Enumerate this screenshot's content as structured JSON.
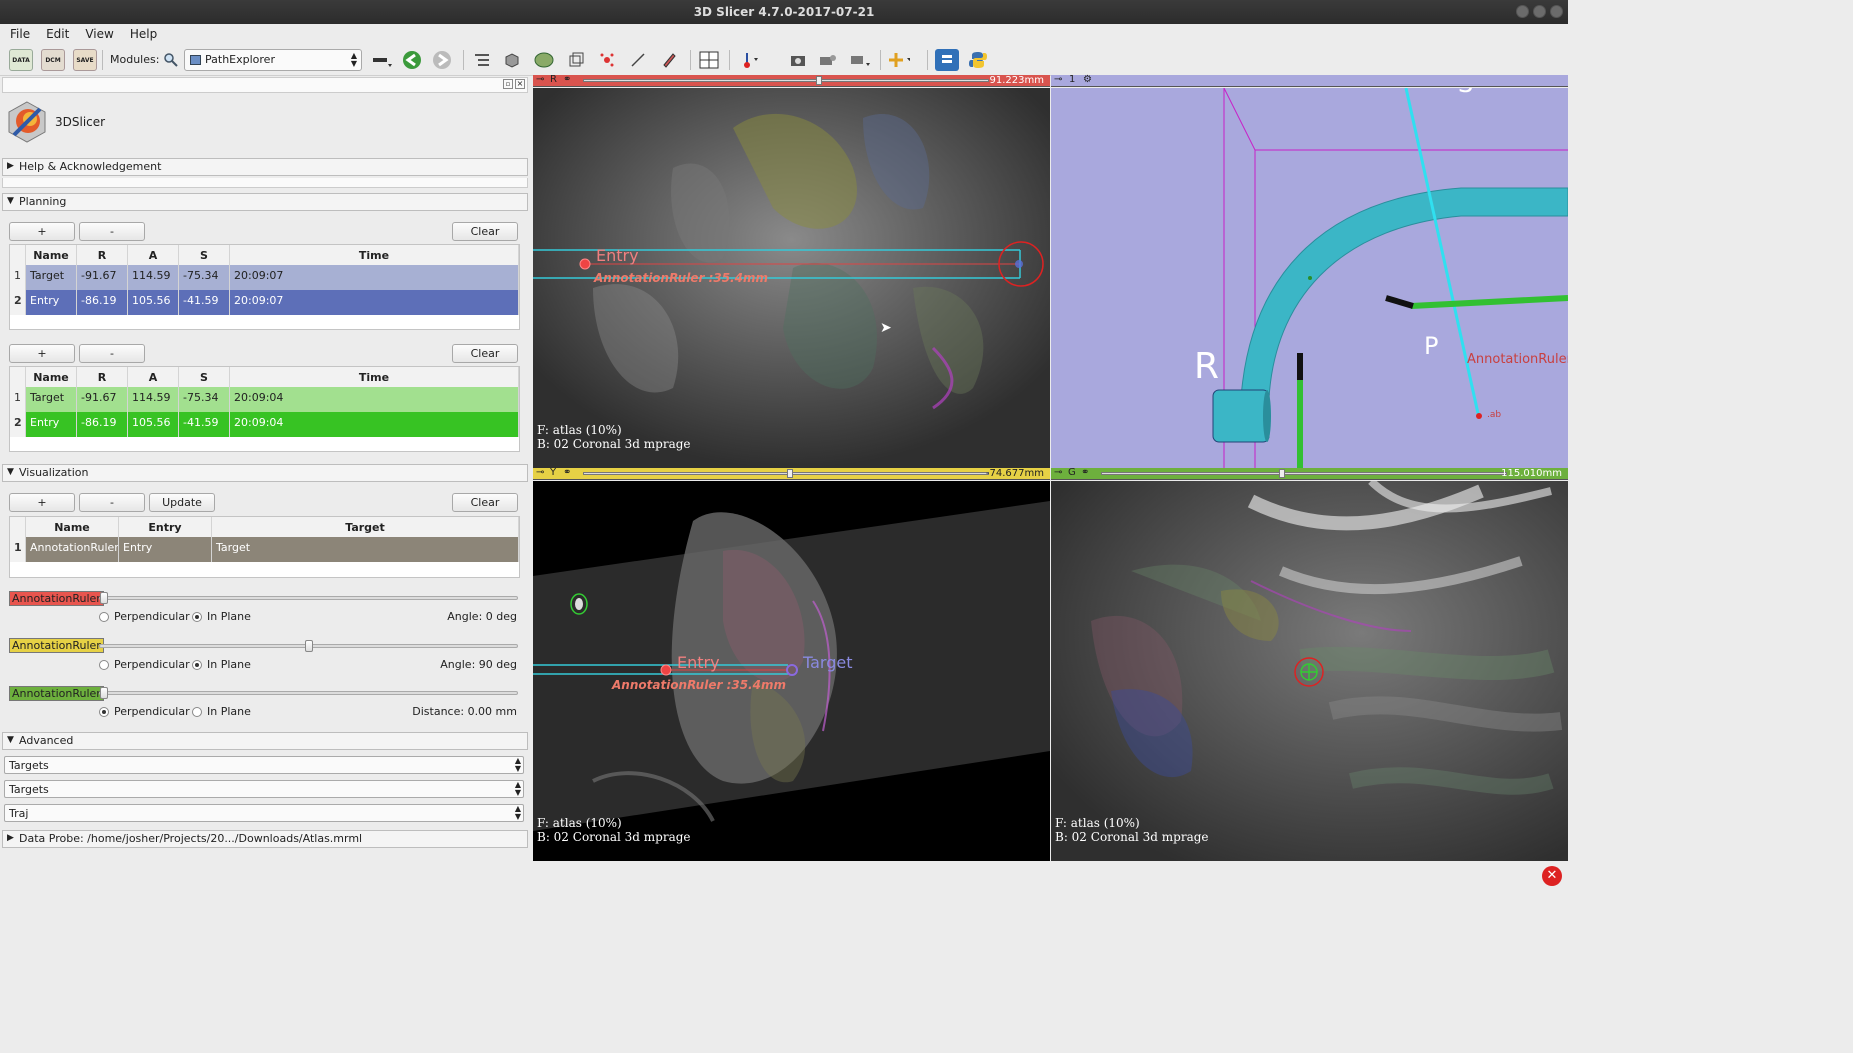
{
  "window": {
    "title": "3D Slicer 4.7.0-2017-07-21"
  },
  "menu": [
    "File",
    "Edit",
    "View",
    "Help"
  ],
  "toolbar": {
    "data_label": "DATA",
    "dcm_label": "DCM",
    "save_label": "SAVE",
    "modules_label": "Modules:",
    "module_selected": "PathExplorer"
  },
  "logo": {
    "text": "3DSlicer"
  },
  "sections": {
    "help": "Help & Acknowledgement",
    "planning": "Planning",
    "visualization": "Visualization",
    "advanced": "Advanced",
    "data_probe": "Data Probe: /home/josher/Projects/20.../Downloads/Atlas.mrml"
  },
  "buttons": {
    "add": "+",
    "remove": "-",
    "clear": "Clear",
    "update": "Update"
  },
  "target_table": {
    "columns": [
      "Name",
      "R",
      "A",
      "S",
      "Time"
    ],
    "rows": [
      {
        "num": "1",
        "name": "Target",
        "r": "-91.67",
        "a": "114.59",
        "s": "-75.34",
        "time": "20:09:07"
      },
      {
        "num": "2",
        "name": "Entry",
        "r": "-86.19",
        "a": "105.56",
        "s": "-41.59",
        "time": "20:09:07"
      }
    ]
  },
  "entry_table": {
    "columns": [
      "Name",
      "R",
      "A",
      "S",
      "Time"
    ],
    "rows": [
      {
        "num": "1",
        "name": "Target",
        "r": "-91.67",
        "a": "114.59",
        "s": "-75.34",
        "time": "20:09:04"
      },
      {
        "num": "2",
        "name": "Entry",
        "r": "-86.19",
        "a": "105.56",
        "s": "-41.59",
        "time": "20:09:04"
      }
    ]
  },
  "trajectory_table": {
    "columns": [
      "Name",
      "Entry",
      "Target"
    ],
    "rows": [
      {
        "num": "1",
        "name": "AnnotationRuler",
        "entry": "Entry",
        "target": "Target"
      }
    ]
  },
  "rulers": [
    {
      "label": "AnnotationRuler",
      "color": "#e8554e",
      "slider_fraction": 0.0,
      "opt1": "Perpendicular",
      "opt2": "In Plane",
      "selected": "In Plane",
      "value_text": "Angle:  0 deg"
    },
    {
      "label": "AnnotationRuler",
      "color": "#e6d145",
      "slider_fraction": 0.5,
      "opt1": "Perpendicular",
      "opt2": "In Plane",
      "selected": "In Plane",
      "value_text": "Angle:  90 deg"
    },
    {
      "label": "AnnotationRuler",
      "color": "#6db03d",
      "slider_fraction": 0.0,
      "opt1": "Perpendicular",
      "opt2": "In Plane",
      "selected": "Perpendicular",
      "value_text": "Distance:  0.00 mm"
    }
  ],
  "advanced_combos": [
    "Targets",
    "Targets",
    "Traj"
  ],
  "views": {
    "red": {
      "letter": "R",
      "offset": "91.223mm",
      "slider_fraction": 0.6,
      "fg": "F: atlas (10%)",
      "bg": "B: 02 Coronal 3d mprage",
      "entry_label": "Entry",
      "ruler_label": "AnnotationRuler :35.4mm",
      "color": "#d9544e"
    },
    "threed": {
      "number": "1",
      "r_label": "R",
      "p_label": "P",
      "s_label": "S",
      "ruler_label": "AnnotationRuler",
      "ruler_value": ".ab"
    },
    "yellow": {
      "letter": "Y",
      "offset": "-74.677mm",
      "slider_fraction": 0.5,
      "fg": "F: atlas (10%)",
      "bg": "B: 02 Coronal 3d mprage",
      "entry_label": "Entry",
      "target_label": "Target",
      "ruler_label": "AnnotationRuler :35.4mm",
      "color": "#e6d145"
    },
    "green": {
      "letter": "G",
      "offset": "115.010mm",
      "slider_fraction": 0.45,
      "fg": "F: atlas (10%)",
      "bg": "B: 02 Coronal 3d mprage",
      "color": "#6db03d"
    }
  },
  "colors": {
    "selected_blue": "#5d6fb8",
    "light_blue": "#a7b0d3",
    "green_row": "#37c323",
    "light_green": "#a2e08f",
    "traj_row": "#8c8578",
    "view3d_bg": "#a9a8dd"
  }
}
